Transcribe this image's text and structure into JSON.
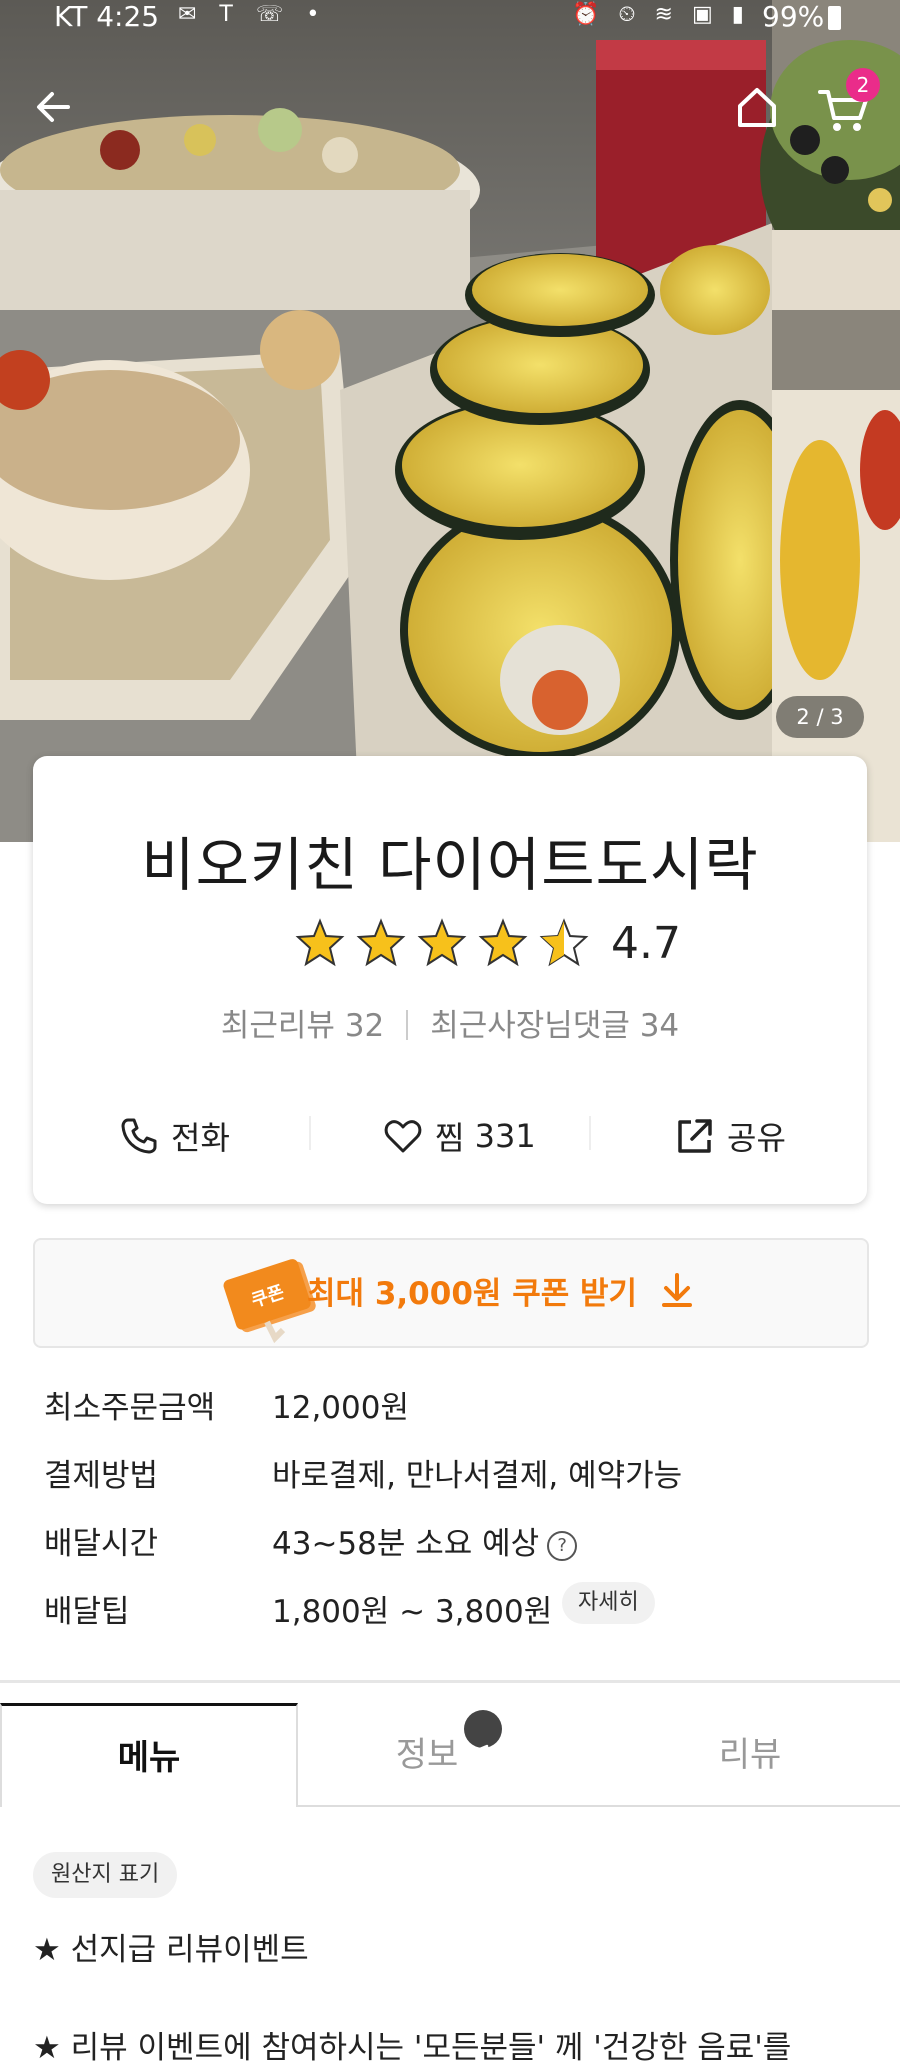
{
  "status_bar": {
    "carrier_time": "KT 4:25",
    "battery": "99%"
  },
  "header": {
    "cart_count": "2",
    "photo_indicator": "2 / 3"
  },
  "store": {
    "name": "비오키친 다이어트도시락",
    "rating": "4.7",
    "rating_value": 4.7,
    "recent_reviews": "최근리뷰 32",
    "owner_replies": "최근사장님댓글 34",
    "actions": {
      "call": "전화",
      "like": "찜",
      "like_count": "331",
      "share": "공유"
    }
  },
  "coupon": {
    "icon_label": "쿠폰",
    "text": "최대 3,000원 쿠폰 받기"
  },
  "info": {
    "min_order_label": "최소주문금액",
    "min_order_value": "12,000원",
    "payment_label": "결제방법",
    "payment_value": "바로결제, 만나서결제, 예약가능",
    "delivery_time_label": "배달시간",
    "delivery_time_value": "43~58분 소요 예상",
    "delivery_tip_label": "배달팁",
    "delivery_tip_value": "1,800원 ~ 3,800원",
    "detail_button": "자세히"
  },
  "tabs": {
    "menu": "메뉴",
    "info": "정보",
    "review": "리뷰"
  },
  "menu_section": {
    "origin_button": "원산지 표기",
    "notice_1": "★ 선지급 리뷰이벤트",
    "notice_2": "★ 리뷰 이벤트에 참여하시는 '모든분들' 께 '건강한 음료'를"
  },
  "colors": {
    "accent_orange": "#f27a0c",
    "star_yellow": "#f7c11b",
    "cart_badge": "#ea2c8a"
  }
}
